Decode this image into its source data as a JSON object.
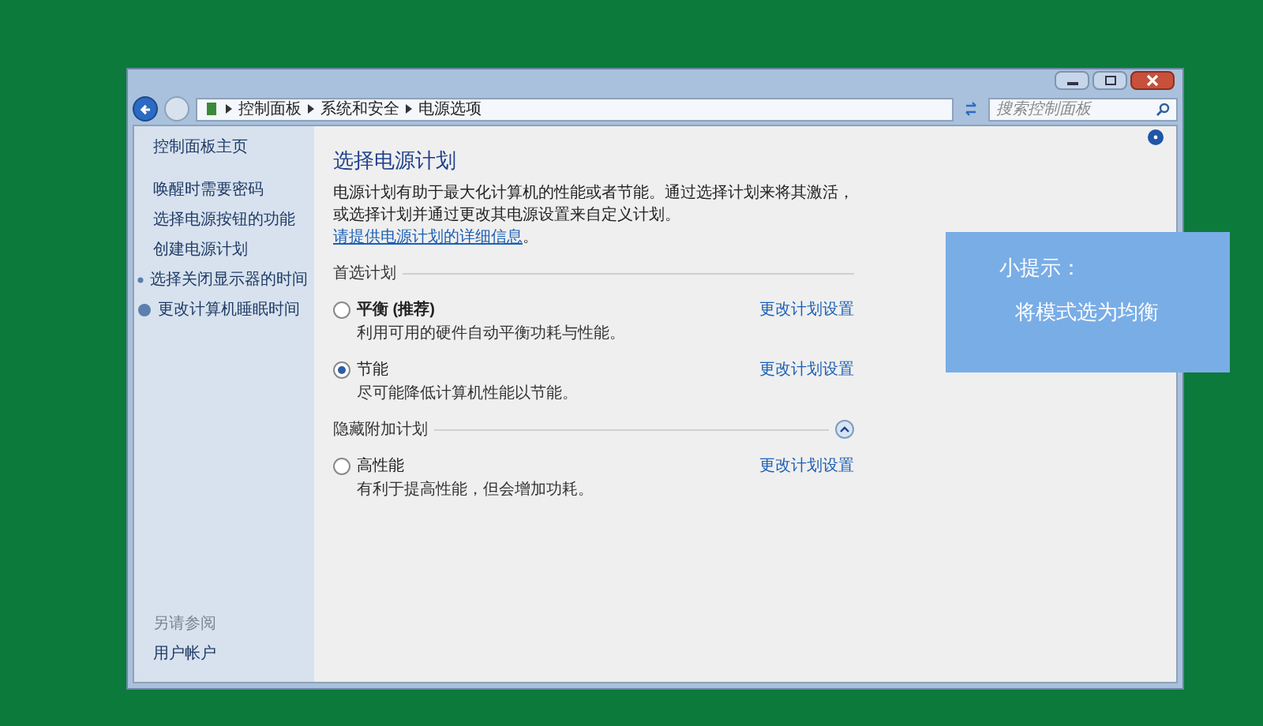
{
  "address_bar": {
    "breadcrumbs": [
      "控制面板",
      "系统和安全",
      "电源选项"
    ]
  },
  "search": {
    "placeholder": "搜索控制面板"
  },
  "sidebar": {
    "items": [
      {
        "label": "控制面板主页",
        "kind": "home"
      },
      {
        "label": "唤醒时需要密码",
        "kind": "link"
      },
      {
        "label": "选择电源按钮的功能",
        "kind": "link"
      },
      {
        "label": "创建电源计划",
        "kind": "link"
      },
      {
        "label": "选择关闭显示器的时间",
        "kind": "icon-link"
      },
      {
        "label": "更改计算机睡眠时间",
        "kind": "icon-link"
      }
    ],
    "see_also": {
      "heading": "另请参阅",
      "links": [
        "用户帐户"
      ]
    }
  },
  "main": {
    "title": "选择电源计划",
    "description": {
      "text": "电源计划有助于最大化计算机的性能或者节能。通过选择计划来将其激活，或选择计划并通过更改其电源设置来自定义计划。",
      "link": "请提供电源计划的详细信息",
      "after": "。"
    },
    "groups": [
      {
        "heading": "首选计划",
        "kind": "plain",
        "plans": [
          {
            "name": "平衡 (推荐)",
            "bold": true,
            "description": "利用可用的硬件自动平衡功耗与性能。",
            "selected": false,
            "action": "更改计划设置"
          },
          {
            "name": "节能",
            "bold": false,
            "description": "尽可能降低计算机性能以节能。",
            "selected": true,
            "action": "更改计划设置"
          }
        ]
      },
      {
        "heading": "隐藏附加计划",
        "kind": "collapsible",
        "expanded": true,
        "plans": [
          {
            "name": "高性能",
            "bold": false,
            "description": "有利于提高性能，但会增加功耗。",
            "selected": false,
            "action": "更改计划设置"
          }
        ]
      }
    ]
  },
  "tip": {
    "title": "小提示：",
    "text": "将模式选为均衡"
  }
}
